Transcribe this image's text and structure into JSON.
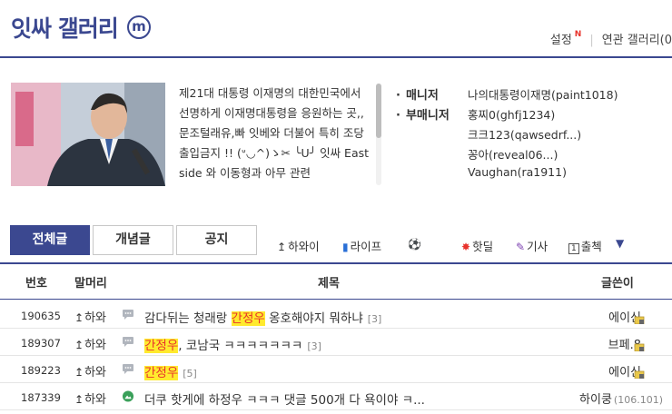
{
  "header": {
    "title": "잇싸 갤러리",
    "badge": "m",
    "settings": "설정",
    "new_mark": "N",
    "related": "연관 갤러리(0"
  },
  "info": {
    "description": "제21대 대통령 이재명의 대한민국에서 선명하게 이재명대통령을 응원하는 곳,, 문조털래유,빠 잇베와 더불어 특히 조당 출입금지 !! (ᐡ◡^)ゝ✂︎ ╰U╯ 잇싸 East side 와 이동형과 아무 관련",
    "manager_label": "매니저",
    "submanager_label": "부매니저",
    "managers": [
      "나의대통령이재명(paint1018)",
      "홍찌0(ghfj1234)",
      "크크123(qawsedrf...)",
      "꽁아(reveal06...)",
      "Vaughan(ra1911)"
    ]
  },
  "tabs": [
    "전체글",
    "개념글",
    "공지"
  ],
  "categories": [
    {
      "icon": "↥",
      "label": "하와이"
    },
    {
      "icon": "▮",
      "label": "라이프"
    },
    {
      "icon": "⚽",
      "label": ""
    },
    {
      "icon": "✸",
      "label": "핫딜"
    },
    {
      "icon": "✎",
      "label": "기사"
    },
    {
      "icon": "1",
      "label": "출첵"
    }
  ],
  "dropdown_icon": "▼",
  "table": {
    "headers": {
      "num": "번호",
      "head": "말머리",
      "title": "제목",
      "writer": "글쓴이"
    },
    "rows": [
      {
        "num": "190635",
        "head": "하와",
        "title_pre": "감다뒤는 청래랑 ",
        "title_hl": "간정우",
        "title_post": " 옹호해야지 뭐하냐",
        "count": "[3]",
        "writer": "에이신",
        "ip": "",
        "icon": "speech",
        "lock": true
      },
      {
        "num": "189307",
        "head": "하와",
        "title_pre": "",
        "title_hl": "간정우",
        "title_post": ", 코남국 ㅋㅋㅋㅋㅋㅋㅋ",
        "count": "[3]",
        "writer": "브페.8",
        "ip": "",
        "icon": "speech",
        "lock": true
      },
      {
        "num": "189223",
        "head": "하와",
        "title_pre": "",
        "title_hl": "간정우",
        "title_post": "",
        "count": "[5]",
        "writer": "에이신",
        "ip": "",
        "icon": "speech",
        "lock": true
      },
      {
        "num": "187339",
        "head": "하와",
        "title_pre": "더쿠 핫게에 하정우 ㅋㅋㅋ 댓글 500개 다 욕이야 ㅋ...",
        "title_hl": "",
        "title_post": "",
        "count": "",
        "writer": "하이쿵",
        "ip": "(106.101)",
        "icon": "image",
        "lock": false
      }
    ]
  },
  "colors": {
    "primary": "#3b4890",
    "highlight": "#ffea2e",
    "highlight_text": "#e8332c"
  }
}
